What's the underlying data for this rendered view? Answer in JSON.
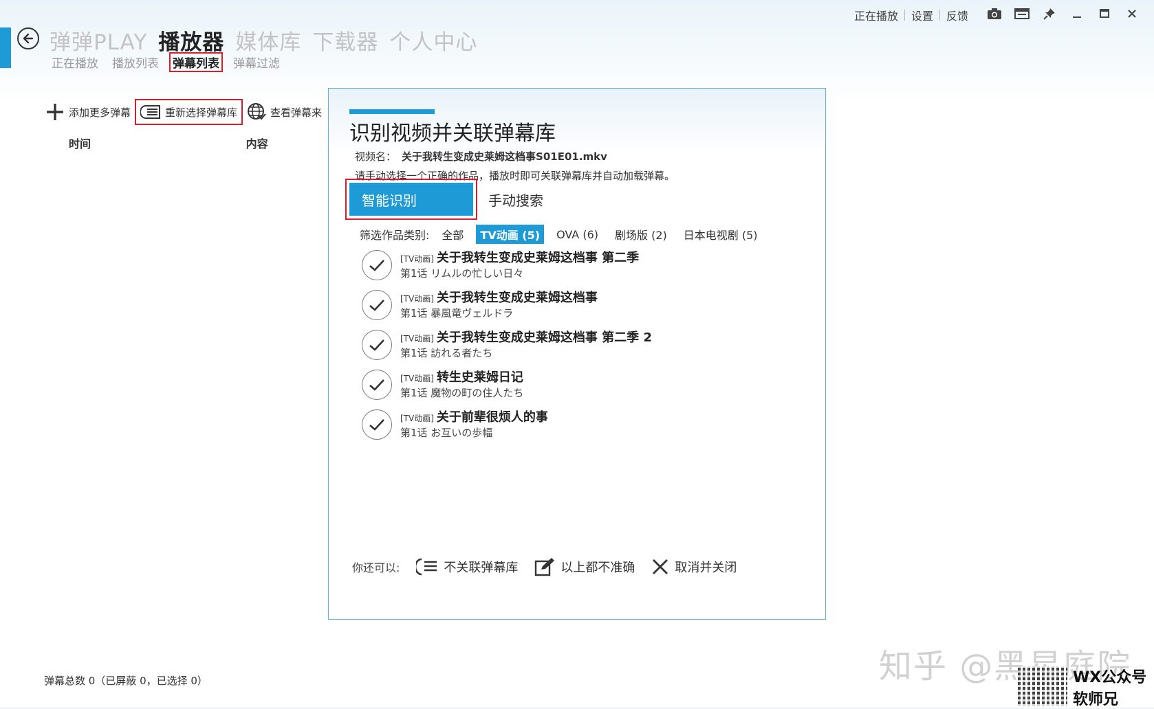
{
  "titlebar": {
    "links": [
      "正在播放",
      "设置",
      "反馈"
    ],
    "icons": [
      "camera-icon",
      "window-icon",
      "pin-icon",
      "minimize-icon",
      "maximize-icon",
      "close-icon"
    ]
  },
  "nav": {
    "main": [
      "弹弹PLAY",
      "播放器",
      "媒体库",
      "下载器",
      "个人中心"
    ],
    "sub": [
      "正在播放",
      "播放列表",
      "弹幕列表",
      "弹幕过滤"
    ]
  },
  "toolbar": {
    "add_label": "添加更多弹幕",
    "reselect_label": "重新选择弹幕库",
    "view_source_label": "查看弹幕来"
  },
  "columns": {
    "time": "时间",
    "content": "内容"
  },
  "footer": {
    "stats": "弹幕总数 0（已屏蔽 0，已选择 0）"
  },
  "dialog": {
    "title": "识别视频并关联弹幕库",
    "video_label": "视频名：",
    "video_name": "关于我转生变成史莱姆这档事S01E01.mkv",
    "instruction": "请手动选择一个正确的作品，播放时即可关联弹幕库并自动加载弹幕。",
    "tabs": {
      "smart": "智能识别",
      "manual": "手动搜索"
    },
    "filter": {
      "label": "筛选作品类别:",
      "chips": [
        "全部",
        "TV动画 (5)",
        "OVA (6)",
        "剧场版 (2)",
        "日本电视剧 (5)"
      ]
    },
    "results": [
      {
        "tag": "[TV动画]",
        "title": "关于我转生变成史莱姆这档事 第二季",
        "sub": "第1话 リムルの忙しい日々"
      },
      {
        "tag": "[TV动画]",
        "title": "关于我转生变成史莱姆这档事",
        "sub": "第1话 暴風竜ヴェルドラ"
      },
      {
        "tag": "[TV动画]",
        "title": "关于我转生变成史莱姆这档事 第二季 2",
        "sub": "第1话 訪れる者たち"
      },
      {
        "tag": "[TV动画]",
        "title": "转生史莱姆日记",
        "sub": "第1话 魔物の町の住人たち"
      },
      {
        "tag": "[TV动画]",
        "title": "关于前辈很烦人的事",
        "sub": "第1话 お互いの歩幅"
      }
    ],
    "footer": {
      "lead": "你还可以:",
      "no_link": "不关联弹幕库",
      "inaccurate": "以上都不准确",
      "cancel": "取消并关闭"
    }
  },
  "watermark": {
    "text": "知乎 @黑星庭院",
    "wx": "WX公众号",
    "wx_sub": "软师兄"
  },
  "colors": {
    "accent": "#1e9ad6",
    "highlight": "#d2202f"
  }
}
